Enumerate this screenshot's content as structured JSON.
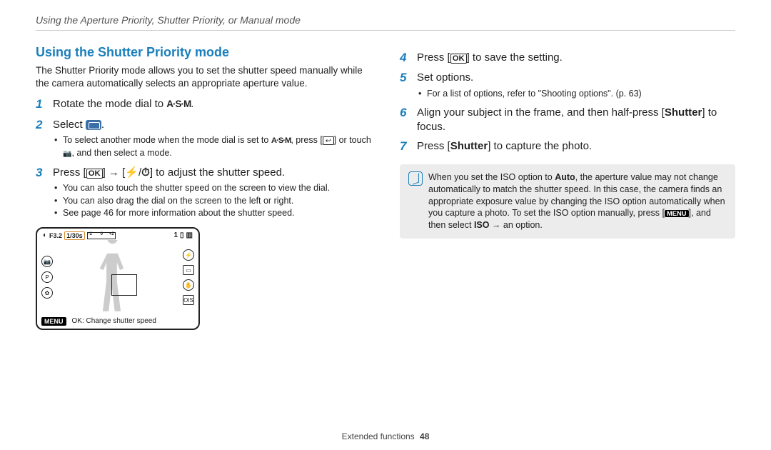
{
  "header": "Using the Aperture Priority, Shutter Priority, or Manual mode",
  "section_title": "Using the Shutter Priority mode",
  "intro": "The Shutter Priority mode allows you to set the shutter speed manually while the camera automatically selects an appropriate aperture value.",
  "glyphs": {
    "asm": "A·S·M",
    "ok": "OK",
    "menu": "MENU",
    "back": "↩",
    "cam": "📷",
    "flash": "⚡",
    "timer": "⏱",
    "arrow": "→"
  },
  "steps_left": {
    "s1_pre": "Rotate the mode dial to ",
    "s1_post": ".",
    "s2_pre": "Select ",
    "s2_post": ".",
    "s2_sub_a_pre": "To select another mode when the mode dial is set to ",
    "s2_sub_a_mid1": ", press [",
    "s2_sub_a_mid2": "] or touch ",
    "s2_sub_a_post": ", and then select a mode.",
    "s3_pre": "Press [",
    "s3_mid1": "] ",
    "s3_mid2": " [",
    "s3_mid3": "/",
    "s3_post": "] to adjust the shutter speed.",
    "s3_sub_a": "You can also touch the shutter speed on the screen to view the dial.",
    "s3_sub_b": "You can also drag the dial on the screen to the left or right.",
    "s3_sub_c": "See page 46 for more information about the shutter speed."
  },
  "preview": {
    "f": "F3.2",
    "shutter": "1/30s",
    "ev_minus": "-2",
    "ev_zero": "0",
    "ev_plus": "+2",
    "count": "1",
    "menu": "MENU",
    "hint": "OK: Change shutter speed"
  },
  "steps_right": {
    "s4_pre": "Press [",
    "s4_post": "] to save the setting.",
    "s5": "Set options.",
    "s5_sub": "For a list of options, refer to \"Shooting options\". (p. 63)",
    "s6_pre": "Align your subject in the frame, and then half-press [",
    "s6_bold": "Shutter",
    "s6_post": "] to focus.",
    "s7_pre": "Press [",
    "s7_bold": "Shutter",
    "s7_post": "] to capture the photo."
  },
  "note": {
    "p1_pre": "When you set the ISO option to ",
    "p1_bold": "Auto",
    "p1_mid": ", the aperture value may not change automatically to match the shutter speed. In this case, the camera finds an appropriate exposure value by changing the ISO option automatically when you capture a photo. To set the ISO option manually, press [",
    "p1_post_pre": "], and then select ",
    "p1_bold2": "ISO",
    "p1_end": " → an option."
  },
  "footer": {
    "label": "Extended functions",
    "page": "48"
  }
}
